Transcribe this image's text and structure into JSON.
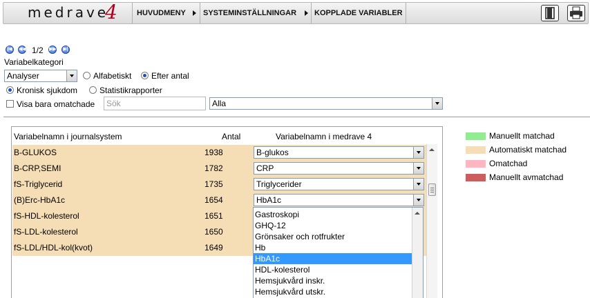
{
  "header": {
    "logo_text": "medrave",
    "logo_number": "4",
    "nav": [
      "HUVUDMENY",
      "SYSTEMINSTÄLLNINGAR",
      "KOPPLADE VARIABLER"
    ]
  },
  "pager": {
    "page_text": "1/2"
  },
  "filters": {
    "category_label": "Variabelkategori",
    "category_value": "Analyser",
    "sort_options": [
      "Alfabetiskt",
      "Efter antal"
    ],
    "sort_selected": "Efter antal",
    "source_options": [
      "Kronisk sjukdom",
      "Statistikrapporter"
    ],
    "source_selected": "Kronisk sjukdom",
    "unmatched_only_label": "Visa bara omatchade",
    "unmatched_only_checked": false,
    "search_placeholder": "Sök",
    "filter_value": "Alla"
  },
  "table": {
    "columns": [
      "Variabelnamn i journalsystem",
      "Antal",
      "Variabelnamn i medrave 4"
    ],
    "rows": [
      {
        "name": "B-GLUKOS",
        "count": "1938",
        "mapped": "B-glukos"
      },
      {
        "name": "B-CRP,SEMI",
        "count": "1782",
        "mapped": "CRP"
      },
      {
        "name": "fS-Triglycerid",
        "count": "1735",
        "mapped": "Triglycerider"
      },
      {
        "name": "(B)Erc-HbA1c",
        "count": "1654",
        "mapped": "HbA1c"
      },
      {
        "name": "fS-HDL-kolesterol",
        "count": "1651",
        "mapped": ""
      },
      {
        "name": "fS-LDL-kolesterol",
        "count": "1650",
        "mapped": ""
      },
      {
        "name": "fS-LDL/HDL-kol(kvot)",
        "count": "1649",
        "mapped": ""
      }
    ]
  },
  "open_dropdown": {
    "options": [
      "Gastroskopi",
      "GHQ-12",
      "Grönsaker och rotfrukter",
      "Hb",
      "HbA1c",
      "HDL-kolesterol",
      "Hemsjukvård inskr.",
      "Hemsjukvård utskr."
    ],
    "selected": "HbA1c"
  },
  "legend": [
    {
      "label": "Manuellt matchad",
      "color": "#90ee90"
    },
    {
      "label": "Automatiskt matchad",
      "color": "#f5ddb5"
    },
    {
      "label": "Omatchad",
      "color": "#ffb6c1"
    },
    {
      "label": "Manuellt avmatchad",
      "color": "#cd5c5c"
    }
  ]
}
